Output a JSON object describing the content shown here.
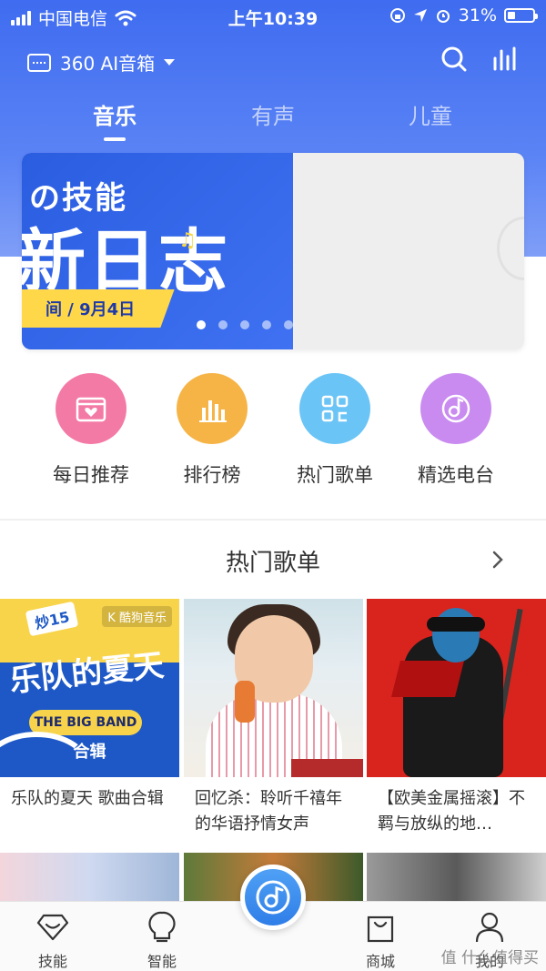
{
  "status_bar": {
    "carrier": "中国电信",
    "time": "上午10:39",
    "battery": "31%",
    "battery_level": 0.31
  },
  "header": {
    "device_name": "360 AI音箱",
    "icons": [
      "speaker-icon",
      "chevron-down-icon",
      "search-icon",
      "equalizer-icon"
    ]
  },
  "tabs": [
    {
      "label": "音乐",
      "active": true
    },
    {
      "label": "有声",
      "active": false
    },
    {
      "label": "儿童",
      "active": false
    }
  ],
  "banner": {
    "line1": "の技能",
    "line2": "新日志",
    "ribbon": "间 / 9月4日",
    "dots_total": 6,
    "active_dot": 1
  },
  "quick_actions": [
    {
      "label": "每日推荐",
      "icon": "calendar-heart-icon",
      "color": "#f47aa6"
    },
    {
      "label": "排行榜",
      "icon": "bar-chart-icon",
      "color": "#f6b447"
    },
    {
      "label": "热门歌单",
      "icon": "grid-list-icon",
      "color": "#6bc4f6"
    },
    {
      "label": "精选电台",
      "icon": "radio-disc-icon",
      "color": "#c98bf0"
    }
  ],
  "section": {
    "title": "热门歌单"
  },
  "playlists": [
    {
      "title": "乐队的夏天 歌曲合辑",
      "cover": {
        "badge": "炒15",
        "logo": "K 酷狗音乐",
        "art_title": "乐队的夏天",
        "band": "THE BIG BAND",
        "sub": "合辑"
      }
    },
    {
      "title": "回忆杀：聆听千禧年的华语抒情女声"
    },
    {
      "title": "【欧美金属摇滚】不羁与放纵的地…"
    }
  ],
  "tab_bar": [
    {
      "label": "技能",
      "icon": "diamond-icon"
    },
    {
      "label": "智能",
      "icon": "lightbulb-icon"
    },
    {
      "label": "",
      "icon": "music-disc-icon"
    },
    {
      "label": "商城",
      "icon": "shopping-bag-icon"
    },
    {
      "label": "我的",
      "icon": "user-icon"
    }
  ],
  "watermark": "值 什么值得买",
  "colors": {
    "header_blue": "#3f6cf0",
    "accent_blue": "#2f7ee8"
  }
}
